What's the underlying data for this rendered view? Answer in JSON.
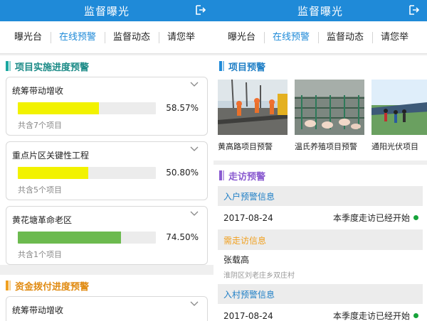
{
  "left": {
    "app_title": "监督曝光",
    "tabs": [
      "曝光台",
      "在线预警",
      "监督动态",
      "请您举"
    ],
    "section_progress": {
      "title": "项目实施进度预警",
      "accent": "#1aa7a0",
      "cards": [
        {
          "name": "统筹带动增收",
          "percent_text": "58.57%",
          "percent": 58.57,
          "color": "#f2f200",
          "count": "共含7个项目"
        },
        {
          "name": "重点片区关键性工程",
          "percent_text": "50.80%",
          "percent": 50.8,
          "color": "#f2f200",
          "count": "共含5个项目"
        },
        {
          "name": "黄花塘革命老区",
          "percent_text": "74.50%",
          "percent": 74.5,
          "color": "#6cba4f",
          "count": "共含1个项目"
        }
      ]
    },
    "section_funding": {
      "title": "资金拨付进度预警",
      "accent": "#f0a020",
      "cards": [
        {
          "name": "统筹带动增收"
        }
      ]
    }
  },
  "right": {
    "app_title": "监督曝光",
    "tabs": [
      "曝光台",
      "在线预警",
      "监督动态",
      "请您举"
    ],
    "section_project": {
      "title": "项目预警",
      "accent": "#1f8ad8",
      "photos": [
        {
          "caption": "黄高路项目预警",
          "scene": "road-construction"
        },
        {
          "caption": "温氏养殖项目预警",
          "scene": "pig-farm"
        },
        {
          "caption": "通阳光伏项目",
          "scene": "solar-field"
        }
      ]
    },
    "section_visit": {
      "title": "走访预警",
      "accent": "#8a5bd0",
      "household_header": "入户预警信息",
      "household": {
        "date": "2017-08-24",
        "status": "本季度走访已经开始"
      },
      "need_header": "需走访信息",
      "need_header_color": "#f0a020",
      "person": {
        "name": "张载高",
        "address": "淮阴区刘老庄乡双庄村"
      },
      "village_header": "入村预警信息",
      "village": {
        "date": "2017-08-24",
        "status": "本季度走访已经开始"
      },
      "status_color": "#16a33a"
    }
  }
}
